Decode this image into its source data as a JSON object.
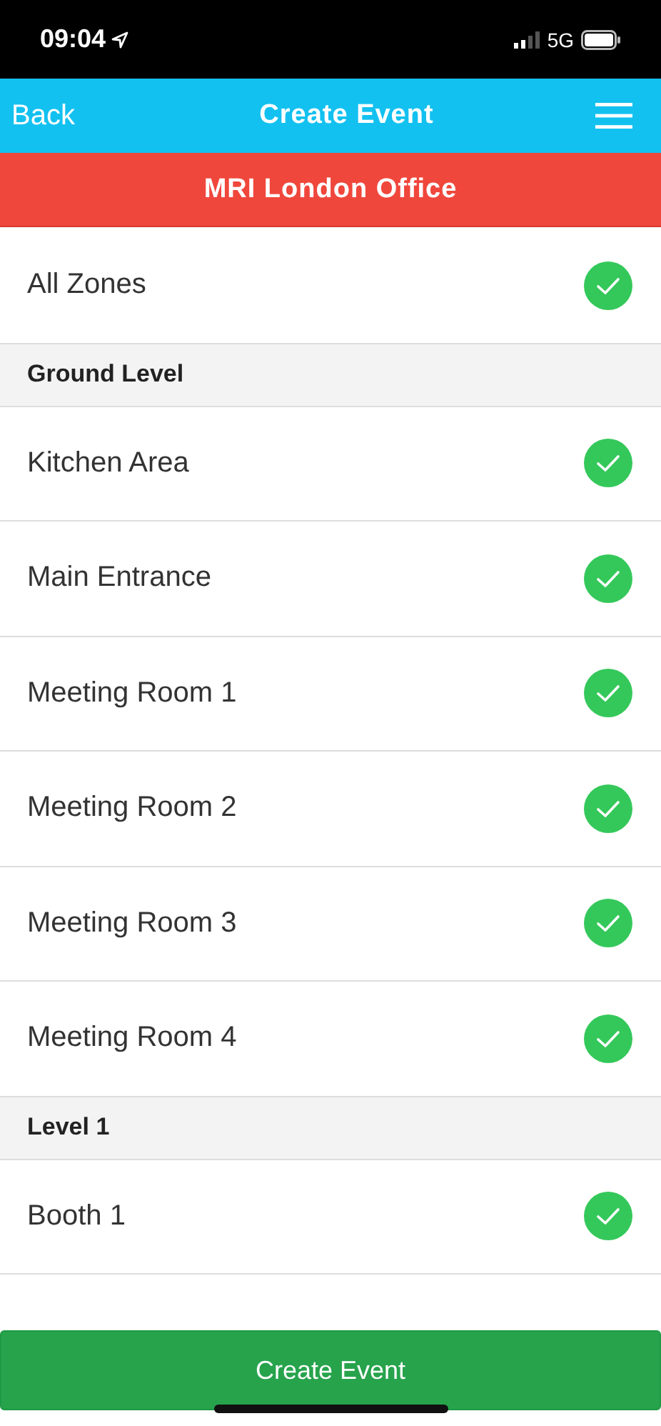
{
  "status_bar": {
    "time": "09:04",
    "network": "5G"
  },
  "nav_bar": {
    "back": "Back",
    "title": "Create Event"
  },
  "site": {
    "name": "MRI London Office"
  },
  "zones": [
    {
      "kind": "row",
      "label": "All Zones",
      "checked": true
    },
    {
      "kind": "header",
      "label": "Ground Level"
    },
    {
      "kind": "row",
      "label": "Kitchen Area",
      "checked": true
    },
    {
      "kind": "row",
      "label": "Main Entrance",
      "checked": true
    },
    {
      "kind": "row",
      "label": "Meeting Room 1",
      "checked": true
    },
    {
      "kind": "row",
      "label": "Meeting Room 2",
      "checked": true
    },
    {
      "kind": "row",
      "label": "Meeting Room 3",
      "checked": true
    },
    {
      "kind": "row",
      "label": "Meeting Room 4",
      "checked": true
    },
    {
      "kind": "header",
      "label": "Level 1"
    },
    {
      "kind": "row",
      "label": "Booth 1",
      "checked": true
    }
  ],
  "action": {
    "label": "Create Event"
  }
}
